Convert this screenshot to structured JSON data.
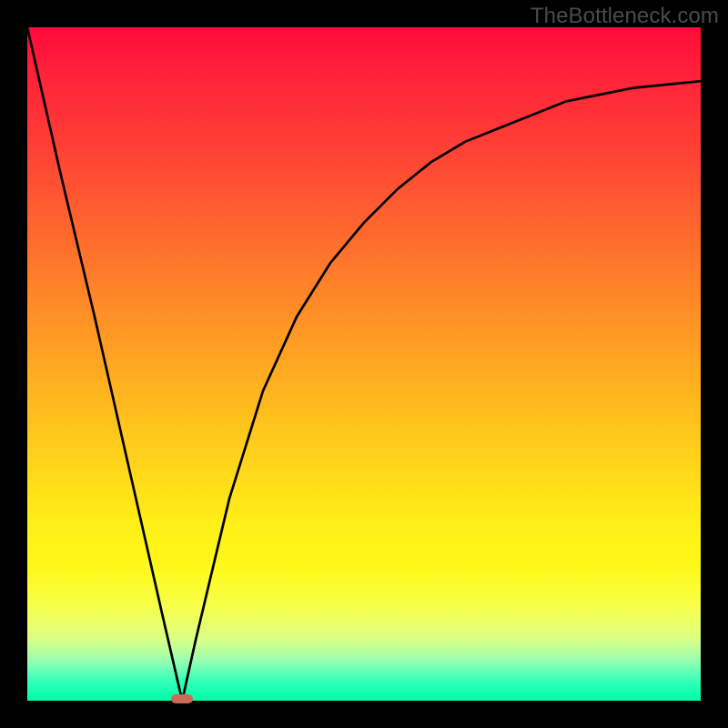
{
  "watermark": {
    "text": "TheBottleneck.com"
  },
  "colors": {
    "frame": "#000000",
    "curve_stroke": "#000000",
    "marker_fill": "#cc6a5a",
    "watermark_text": "#4a4a4a"
  },
  "chart_data": {
    "type": "line",
    "title": "",
    "xlabel": "",
    "ylabel": "",
    "xlim": [
      0,
      100
    ],
    "ylim": [
      0,
      100
    ],
    "grid": false,
    "legend": false,
    "notes": "V-shaped bottleneck curve over a vertical spectrum gradient (red→green). The curve descends from top-left to a single minimum near x≈23, then rises asymptotically toward the right. A small rounded marker sits at the minimum. Values are estimated from pixel positions.",
    "series": [
      {
        "name": "curve",
        "x": [
          0,
          5,
          10,
          15,
          20,
          23,
          25,
          30,
          35,
          40,
          45,
          50,
          55,
          60,
          65,
          70,
          75,
          80,
          85,
          90,
          95,
          100
        ],
        "y": [
          100,
          78,
          57,
          35,
          13,
          0,
          9,
          30,
          46,
          57,
          65,
          71,
          76,
          80,
          83,
          85,
          87,
          89,
          90,
          91,
          91.5,
          92
        ]
      }
    ],
    "marker": {
      "x": 23,
      "y": 0
    }
  }
}
